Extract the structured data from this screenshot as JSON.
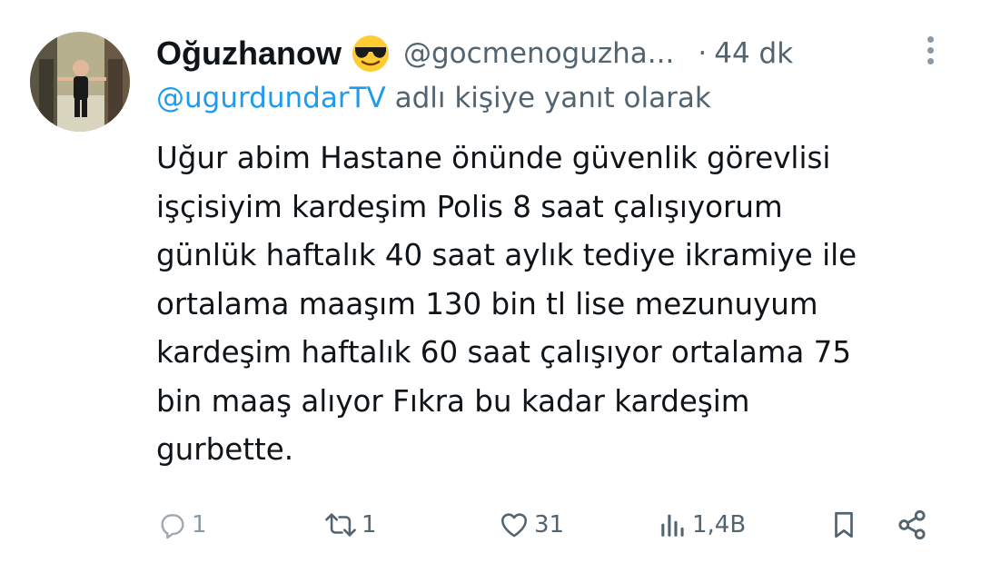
{
  "user": {
    "display_name": "Oğuzhanow",
    "emoji_icon": "sunglasses-emoji-icon",
    "handle": "@gocmenoguzha...",
    "dot": "·",
    "time": "44 dk"
  },
  "reply_to": {
    "mention": "@ugurdundarTV",
    "suffix": " adlı kişiye yanıt olarak"
  },
  "tweet": {
    "lines": [
      "Uğur abim Hastane önünde güvenlik görevlisi",
      "işçisiyim kardeşim Polis 8 saat çalışıyorum",
      "günlük haftalık 40 saat aylık tediye ikramiye ile",
      "ortalama maaşım 130 bin tl lise mezunuyum",
      "kardeşim haftalık 60 saat çalışıyor ortalama 75",
      "bin maaş alıyor Fıkra bu kadar kardeşim",
      "gurbette."
    ]
  },
  "actions": {
    "reply": {
      "icon": "reply-icon",
      "count": "1"
    },
    "retweet": {
      "icon": "retweet-icon",
      "count": "1"
    },
    "like": {
      "icon": "heart-icon",
      "count": "31"
    },
    "views": {
      "icon": "views-icon",
      "count": "1,4B"
    },
    "bookmark": {
      "icon": "bookmark-icon"
    },
    "share": {
      "icon": "share-icon"
    }
  },
  "colors": {
    "text": "#0f1419",
    "secondary": "#536471",
    "link": "#1d9bf0",
    "background": "#ffffff"
  }
}
